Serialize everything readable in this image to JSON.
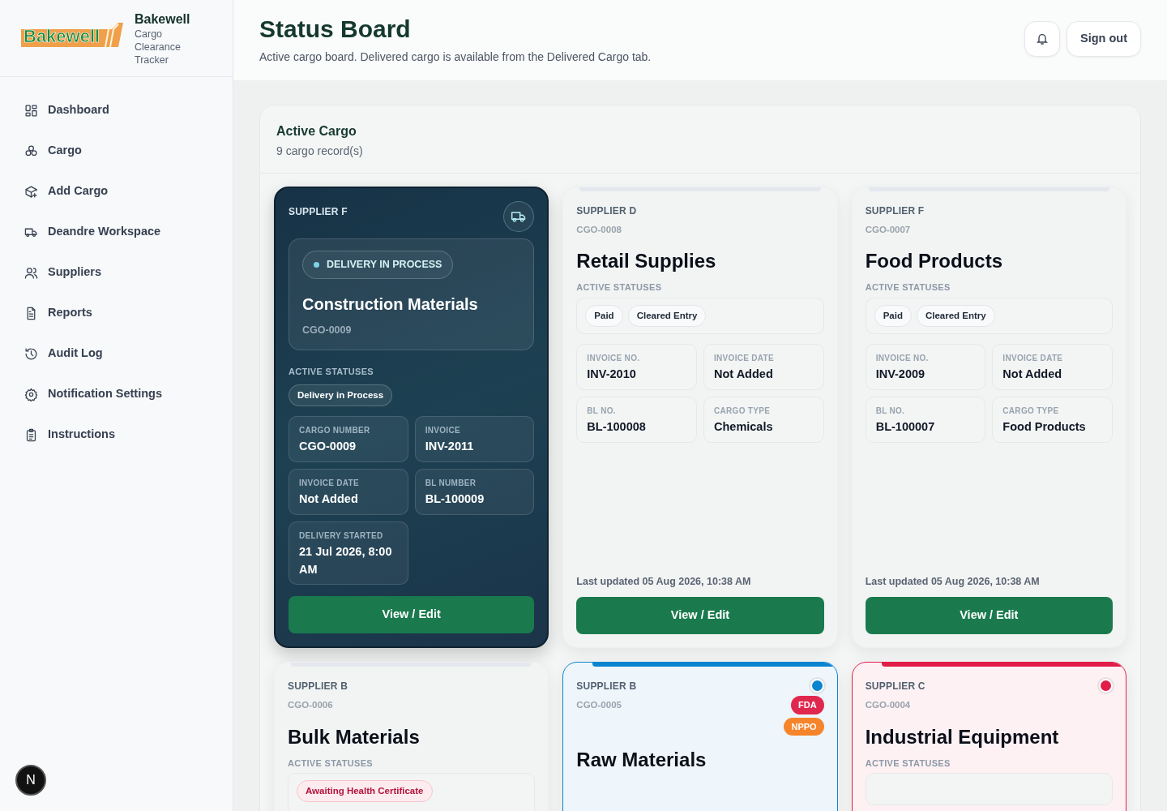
{
  "brand": {
    "name": "Bakewell",
    "subtitle": "Cargo Clearance Tracker",
    "logo_text": "Bakewell"
  },
  "nav": [
    {
      "label": "Dashboard",
      "selected": false
    },
    {
      "label": "Cargo",
      "selected": false
    },
    {
      "label": "Add Cargo",
      "selected": false
    },
    {
      "label": "Deandre Workspace",
      "selected": false
    },
    {
      "label": "Suppliers",
      "selected": false
    },
    {
      "label": "Reports",
      "selected": false
    },
    {
      "label": "Audit Log",
      "selected": false
    },
    {
      "label": "Notification Settings",
      "selected": false
    },
    {
      "label": "Instructions",
      "selected": false
    }
  ],
  "dev_badge": "N",
  "header": {
    "title": "Status Board",
    "subtitle": "Active cargo board. Delivered cargo is available from the Delivered Cargo tab.",
    "sign_out": "Sign out"
  },
  "panel": {
    "title": "Active Cargo",
    "count": "9 cargo record(s)"
  },
  "cards": [
    {
      "kind": "featured",
      "supplier": "SUPPLIER F",
      "status_pill": "DELIVERY IN PROCESS",
      "name": "Construction Materials",
      "code": "CGO-0009",
      "statuses_label": "ACTIVE STATUSES",
      "statuses": [
        {
          "label": "Delivery in Process",
          "kind": "neutral"
        }
      ],
      "fields": [
        {
          "label": "CARGO NUMBER",
          "value": "CGO-0009"
        },
        {
          "label": "INVOICE",
          "value": "INV-2011"
        },
        {
          "label": "INVOICE DATE",
          "value": "Not Added"
        },
        {
          "label": "BL NUMBER",
          "value": "BL-100009"
        },
        {
          "label": "DELIVERY STARTED",
          "value": "21 Jul 2026, 8:00 AM"
        }
      ],
      "button": "View / Edit"
    },
    {
      "kind": "standard",
      "supplier": "SUPPLIER D",
      "code": "CGO-0008",
      "name": "Retail Supplies",
      "statuses_label": "ACTIVE STATUSES",
      "statuses": [
        {
          "label": "Paid",
          "kind": "neutral"
        },
        {
          "label": "Cleared Entry",
          "kind": "neutral"
        }
      ],
      "fields": [
        {
          "label": "INVOICE NO.",
          "value": "INV-2010"
        },
        {
          "label": "INVOICE DATE",
          "value": "Not Added"
        },
        {
          "label": "BL NO.",
          "value": "BL-100008"
        },
        {
          "label": "CARGO TYPE",
          "value": "Chemicals"
        }
      ],
      "updated": "Last updated 05 Aug 2026, 10:38 AM",
      "button": "View / Edit"
    },
    {
      "kind": "standard",
      "supplier": "SUPPLIER F",
      "code": "CGO-0007",
      "name": "Food Products",
      "statuses_label": "ACTIVE STATUSES",
      "statuses": [
        {
          "label": "Paid",
          "kind": "neutral"
        },
        {
          "label": "Cleared Entry",
          "kind": "neutral"
        }
      ],
      "fields": [
        {
          "label": "INVOICE NO.",
          "value": "INV-2009"
        },
        {
          "label": "INVOICE DATE",
          "value": "Not Added"
        },
        {
          "label": "BL NO.",
          "value": "BL-100007"
        },
        {
          "label": "CARGO TYPE",
          "value": "Food Products"
        }
      ],
      "updated": "Last updated 05 Aug 2026, 10:38 AM",
      "button": "View / Edit"
    },
    {
      "kind": "standard",
      "supplier": "SUPPLIER B",
      "code": "CGO-0006",
      "name": "Bulk Materials",
      "statuses_label": "ACTIVE STATUSES",
      "statuses": [
        {
          "label": "Awaiting Health Certificate",
          "kind": "alert"
        }
      ]
    },
    {
      "kind": "standard",
      "supplier": "SUPPLIER B",
      "code": "CGO-0005",
      "name": "Raw Materials",
      "color": "#0b84d0",
      "tags": [
        {
          "label": "FDA",
          "color": "#e0284f"
        },
        {
          "label": "NPPO",
          "color": "#f5842a"
        }
      ]
    },
    {
      "kind": "standard",
      "supplier": "SUPPLIER C",
      "code": "CGO-0004",
      "name": "Industrial Equipment",
      "color": "#e11d48",
      "statuses_label": "ACTIVE STATUSES"
    }
  ]
}
